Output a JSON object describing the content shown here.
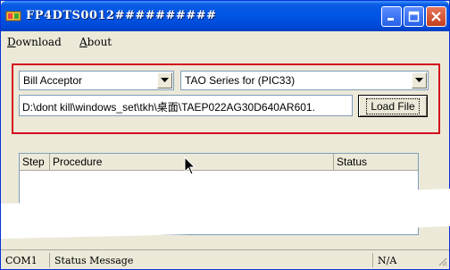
{
  "window": {
    "title": "FP4DTS0012##########"
  },
  "menu": {
    "download": "Download",
    "download_accel": "D",
    "about": "About",
    "about_accel": "A"
  },
  "device_type": {
    "selected": "Bill Acceptor"
  },
  "series": {
    "selected": "TAO Series for (PIC33)"
  },
  "file": {
    "path": "D:\\dont kill\\windows_set\\tkh\\桌面\\TAEP022AG30D640AR601.",
    "load_label": "Load File"
  },
  "table": {
    "columns": [
      "Step",
      "Procedure",
      "Status"
    ],
    "rows": []
  },
  "status": {
    "port": "COM1",
    "message": "Status Message",
    "value": "N/A"
  },
  "icons": {
    "title": "app-icon",
    "minimize": "minimize-icon",
    "maximize": "maximize-icon",
    "close": "close-icon",
    "dropdown": "chevron-down-icon",
    "cursor": "mouse-cursor-icon"
  },
  "colors": {
    "titlebar": "#0055e5",
    "panel_border": "#d40d1e",
    "window_bg": "#ece9d8",
    "close_button": "#c23e1d"
  }
}
